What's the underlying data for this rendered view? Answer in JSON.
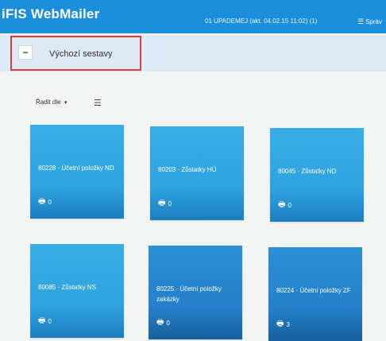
{
  "header": {
    "title": "iFIS WebMailer",
    "status": "01 UPADEMEJ (akt. 04.02.15 11:02) (1)",
    "menu_label": "Správ",
    "menu_icon": "hamburger-icon"
  },
  "section": {
    "toggle_symbol": "−",
    "title": "Výchozí sestavy"
  },
  "toolbar": {
    "sort_label": "Řadit dle",
    "sort_caret": "▾",
    "view_toggle_symbol": "☰"
  },
  "tiles": [
    {
      "title": "80228 · Účetní položky ND",
      "count": "0"
    },
    {
      "title": "80203 · Zůstatky HÚ",
      "count": "0"
    },
    {
      "title": "80045 · Zůstatky ND",
      "count": "0"
    },
    {
      "title": "80085 · Zůstatky NS",
      "count": "0"
    },
    {
      "title": "80225 · Účetní položky zakázky",
      "count": "0"
    },
    {
      "title": "80224 · Účetní položky ZF",
      "count": "3"
    }
  ],
  "colors": {
    "accent": "#1b8fdc",
    "tile": "#2ea3e0",
    "tile_dark": "#2580c9",
    "highlight_border": "#e03a3e"
  }
}
